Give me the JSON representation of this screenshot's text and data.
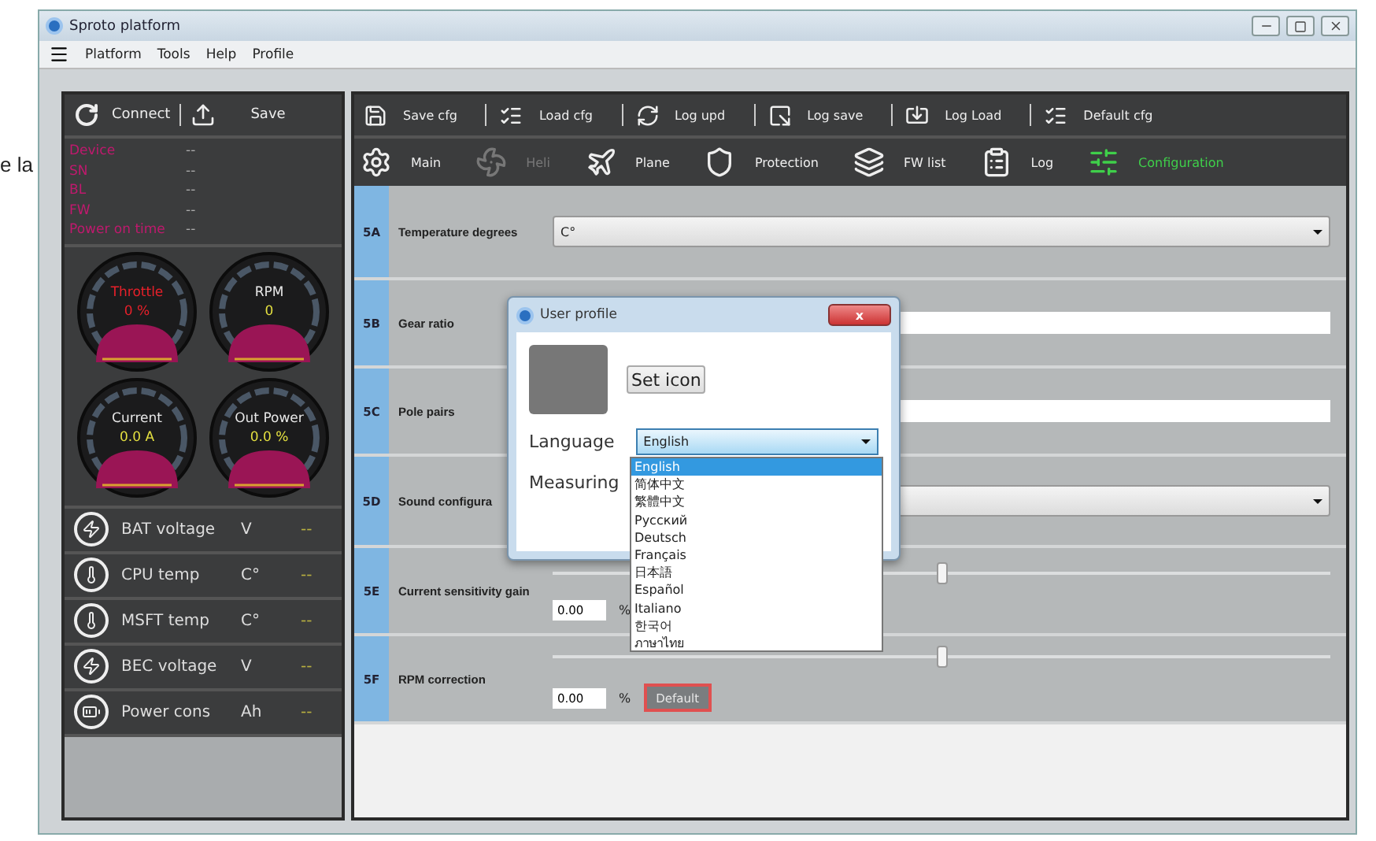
{
  "margin_text": "e la",
  "window": {
    "title": "Sproto platform"
  },
  "menu": [
    "Platform",
    "Tools",
    "Help",
    "Profile"
  ],
  "left_panel": {
    "connect": "Connect",
    "save": "Save",
    "info": [
      {
        "label": "Device",
        "value": "--"
      },
      {
        "label": "SN",
        "value": "--"
      },
      {
        "label": "BL",
        "value": "--"
      },
      {
        "label": "FW",
        "value": "--"
      },
      {
        "label": "Power on time",
        "value": "--"
      }
    ],
    "gauges": [
      {
        "label": "Throttle",
        "value": "0 %",
        "alert": true
      },
      {
        "label": "RPM",
        "value": "0",
        "alert": false
      },
      {
        "label": "Current",
        "value": "0.0 A",
        "alert": false
      },
      {
        "label": "Out Power",
        "value": "0.0 %",
        "alert": false
      }
    ],
    "sensors": [
      {
        "kind": "bolt",
        "label": "BAT voltage",
        "unit": "V",
        "value": "--"
      },
      {
        "kind": "cpu",
        "label": "CPU temp",
        "unit": "C°",
        "value": "--"
      },
      {
        "kind": "fet",
        "label": "MSFT temp",
        "unit": "C°",
        "value": "--"
      },
      {
        "kind": "bec",
        "label": "BEC voltage",
        "unit": "V",
        "value": "--"
      },
      {
        "kind": "battery",
        "label": "Power cons",
        "unit": "Ah",
        "value": "--"
      }
    ]
  },
  "toolbar": [
    {
      "kind": "save",
      "label": "Save cfg"
    },
    {
      "kind": "list",
      "label": "Load cfg"
    },
    {
      "kind": "refresh",
      "label": "Log upd"
    },
    {
      "kind": "export",
      "label": "Log save"
    },
    {
      "kind": "import",
      "label": "Log Load"
    },
    {
      "kind": "list",
      "label": "Default cfg"
    }
  ],
  "tabs": [
    {
      "kind": "gear",
      "label": "Main",
      "selected": false,
      "disabled": false
    },
    {
      "kind": "heli",
      "label": "Heli",
      "selected": false,
      "disabled": true
    },
    {
      "kind": "plane",
      "label": "Plane",
      "selected": false,
      "disabled": false
    },
    {
      "kind": "shield",
      "label": "Protection",
      "selected": false,
      "disabled": false
    },
    {
      "kind": "layers",
      "label": "FW list",
      "selected": false,
      "disabled": false
    },
    {
      "kind": "clipboard",
      "label": "Log",
      "selected": false,
      "disabled": false
    },
    {
      "kind": "sliders",
      "label": "Configuration",
      "selected": true,
      "disabled": false
    }
  ],
  "settings": [
    {
      "code": "5A",
      "label": "Temperature degrees",
      "kind": "select",
      "value": "C°"
    },
    {
      "code": "5B",
      "label": "Gear ratio",
      "kind": "input"
    },
    {
      "code": "5C",
      "label": "Pole pairs",
      "kind": "input"
    },
    {
      "code": "5D",
      "label": "Sound configura",
      "kind": "select"
    },
    {
      "code": "5E",
      "label": "Current sensitivity gain",
      "kind": "slider",
      "level": 0.5,
      "value": "0.00",
      "unit": "%"
    },
    {
      "code": "5F",
      "label": "RPM correction",
      "kind": "slider",
      "level": 0.5,
      "value": "0.00",
      "unit": "%",
      "button": "Default"
    }
  ],
  "dialog": {
    "title": "User profile",
    "close": "x",
    "set_icon": "Set icon",
    "language_label": "Language",
    "language_value": "English",
    "measuring_label": "Measuring",
    "options": [
      {
        "label": "English",
        "selected": true
      },
      {
        "label": "简体中文",
        "selected": false
      },
      {
        "label": "繁體中文",
        "selected": false
      },
      {
        "label": "Русский",
        "selected": false
      },
      {
        "label": "Deutsch",
        "selected": false
      },
      {
        "label": "Français",
        "selected": false
      },
      {
        "label": "日本語",
        "selected": false
      },
      {
        "label": "Español",
        "selected": false
      },
      {
        "label": "Italiano",
        "selected": false
      },
      {
        "label": "한국어",
        "selected": false
      },
      {
        "label": "ภาษาไทย",
        "selected": false
      }
    ]
  }
}
